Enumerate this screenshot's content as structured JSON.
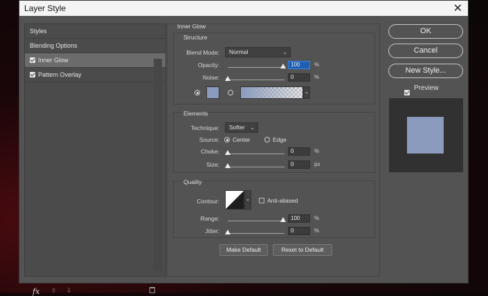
{
  "window": {
    "title": "Layer Style",
    "close_glyph": "✕"
  },
  "sidebar": {
    "items": [
      {
        "label": "Styles",
        "checked": null,
        "selected": false
      },
      {
        "label": "Blending Options",
        "checked": null,
        "selected": false
      },
      {
        "label": "Inner Glow",
        "checked": true,
        "selected": true
      },
      {
        "label": "Pattern Overlay",
        "checked": true,
        "selected": false
      }
    ],
    "fx_label": "fx",
    "up_glyph": "⇧",
    "down_glyph": "⇩",
    "trash_icon": "trash-icon"
  },
  "panel": {
    "section_title": "Inner Glow",
    "structure": {
      "title": "Structure",
      "blend_mode_label": "Blend Mode:",
      "blend_mode_value": "Normal",
      "opacity_label": "Opacity:",
      "opacity_value": "100",
      "opacity_unit": "%",
      "opacity_level": 100,
      "noise_label": "Noise:",
      "noise_value": "0",
      "noise_unit": "%",
      "noise_level": 0,
      "color_swatch": "#8a9bbd",
      "color_mode_selected": "solid"
    },
    "elements": {
      "title": "Elements",
      "technique_label": "Technique:",
      "technique_value": "Softer",
      "source_label": "Source:",
      "source_center": "Center",
      "source_edge": "Edge",
      "source_selected": "center",
      "choke_label": "Choke:",
      "choke_value": "0",
      "choke_unit": "%",
      "choke_level": 0,
      "size_label": "Size:",
      "size_value": "0",
      "size_unit": "px",
      "size_level": 0
    },
    "quality": {
      "title": "Quality",
      "contour_label": "Contour:",
      "anti_aliased_label": "Anti-aliased",
      "anti_aliased_checked": false,
      "range_label": "Range:",
      "range_value": "100",
      "range_unit": "%",
      "range_level": 100,
      "jitter_label": "Jitter:",
      "jitter_value": "0",
      "jitter_unit": "%",
      "jitter_level": 0
    },
    "make_default_label": "Make Default",
    "reset_default_label": "Reset to Default"
  },
  "actions": {
    "ok_label": "OK",
    "cancel_label": "Cancel",
    "new_style_label": "New Style...",
    "preview_label": "Preview",
    "preview_checked": true,
    "preview_swatch": "#8a9bbd"
  }
}
